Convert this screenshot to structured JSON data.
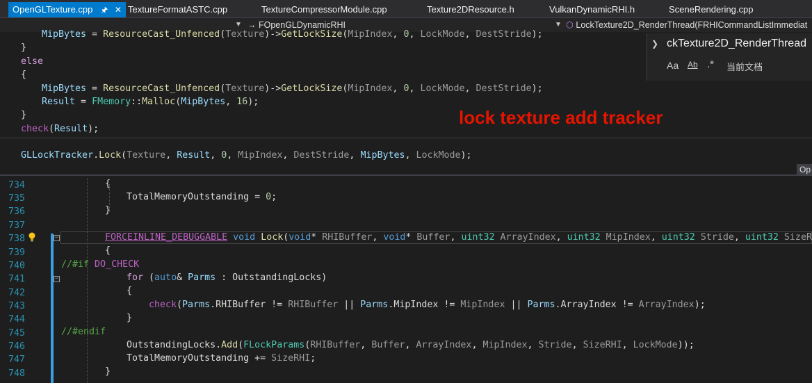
{
  "tabs": [
    {
      "label": "OpenGLTexture.cpp",
      "active": true
    },
    {
      "label": "TextureFormatASTC.cpp"
    },
    {
      "label": "TextureCompressorModule.cpp"
    },
    {
      "label": "Texture2DResource.h"
    },
    {
      "label": "VulkanDynamicRHI.h"
    },
    {
      "label": "SceneRendering.cpp"
    }
  ],
  "nav": {
    "scope": "FOpenGLDynamicRHI",
    "member": "LockTexture2D_RenderThread(FRHICommandListImmediat"
  },
  "find": {
    "query": "ckTexture2D_RenderThread",
    "scope": "当前文档"
  },
  "annotation": "lock texture add tracker",
  "peek_button": "Op",
  "peek_lines": [
    "MipBytes = ResourceCast_Unfenced(Texture)->GetLockSize(MipIndex, 0, LockMode, DestStride);",
    "}",
    "else",
    "{",
    "MipBytes = ResourceCast_Unfenced(Texture)->GetLockSize(MipIndex, 0, LockMode, DestStride);",
    "Result = FMemory::Malloc(MipBytes, 16);",
    "}",
    "check(Result);",
    "GLLockTracker.Lock(Texture, Result, 0, MipIndex, DestStride, MipBytes, LockMode);"
  ],
  "line_numbers": [
    "734",
    "735",
    "736",
    "737",
    "738",
    "739",
    "740",
    "741",
    "742",
    "743",
    "744",
    "745",
    "746",
    "747",
    "748"
  ],
  "colors": {
    "accent": "#007acc",
    "annotation": "#e51400",
    "linenumber": "#2b91af"
  }
}
